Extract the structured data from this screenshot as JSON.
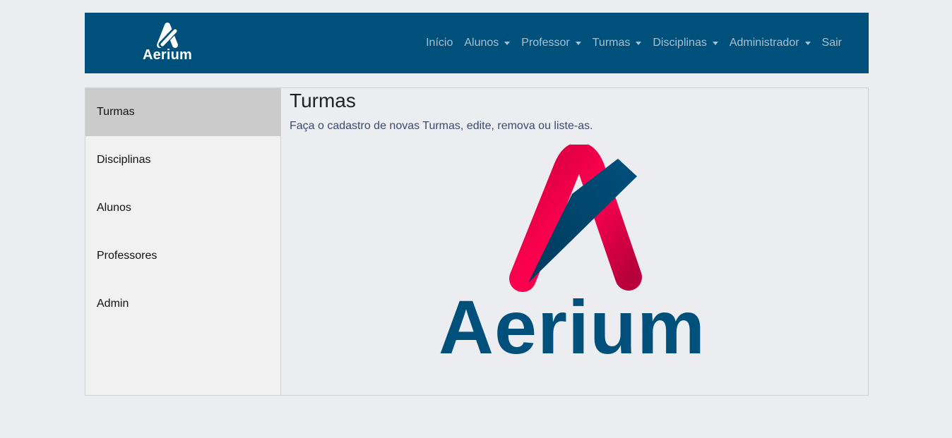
{
  "navbar": {
    "brand": "Aerium",
    "links": [
      {
        "label": "Início",
        "dropdown": false
      },
      {
        "label": "Alunos",
        "dropdown": true
      },
      {
        "label": "Professor",
        "dropdown": true
      },
      {
        "label": "Turmas",
        "dropdown": true
      },
      {
        "label": "Disciplinas",
        "dropdown": true
      },
      {
        "label": "Administrador",
        "dropdown": true
      },
      {
        "label": "Sair",
        "dropdown": false
      }
    ]
  },
  "sidebar": {
    "items": [
      {
        "label": "Turmas",
        "active": true
      },
      {
        "label": "Disciplinas",
        "active": false
      },
      {
        "label": "Alunos",
        "active": false
      },
      {
        "label": "Professores",
        "active": false
      },
      {
        "label": "Admin",
        "active": false
      }
    ]
  },
  "main": {
    "title": "Turmas",
    "description": "Faça o cadastro de novas Turmas, edite, remova ou liste-as.",
    "logo_text": "Aerium"
  },
  "colors": {
    "navbar_bg": "#00507c",
    "page_bg": "#ecedf1",
    "logo_red": "#e8004a",
    "logo_blue": "#00507c"
  },
  "icons": {
    "brand": "aerium-logo-icon",
    "dropdown": "caret-down-icon"
  }
}
